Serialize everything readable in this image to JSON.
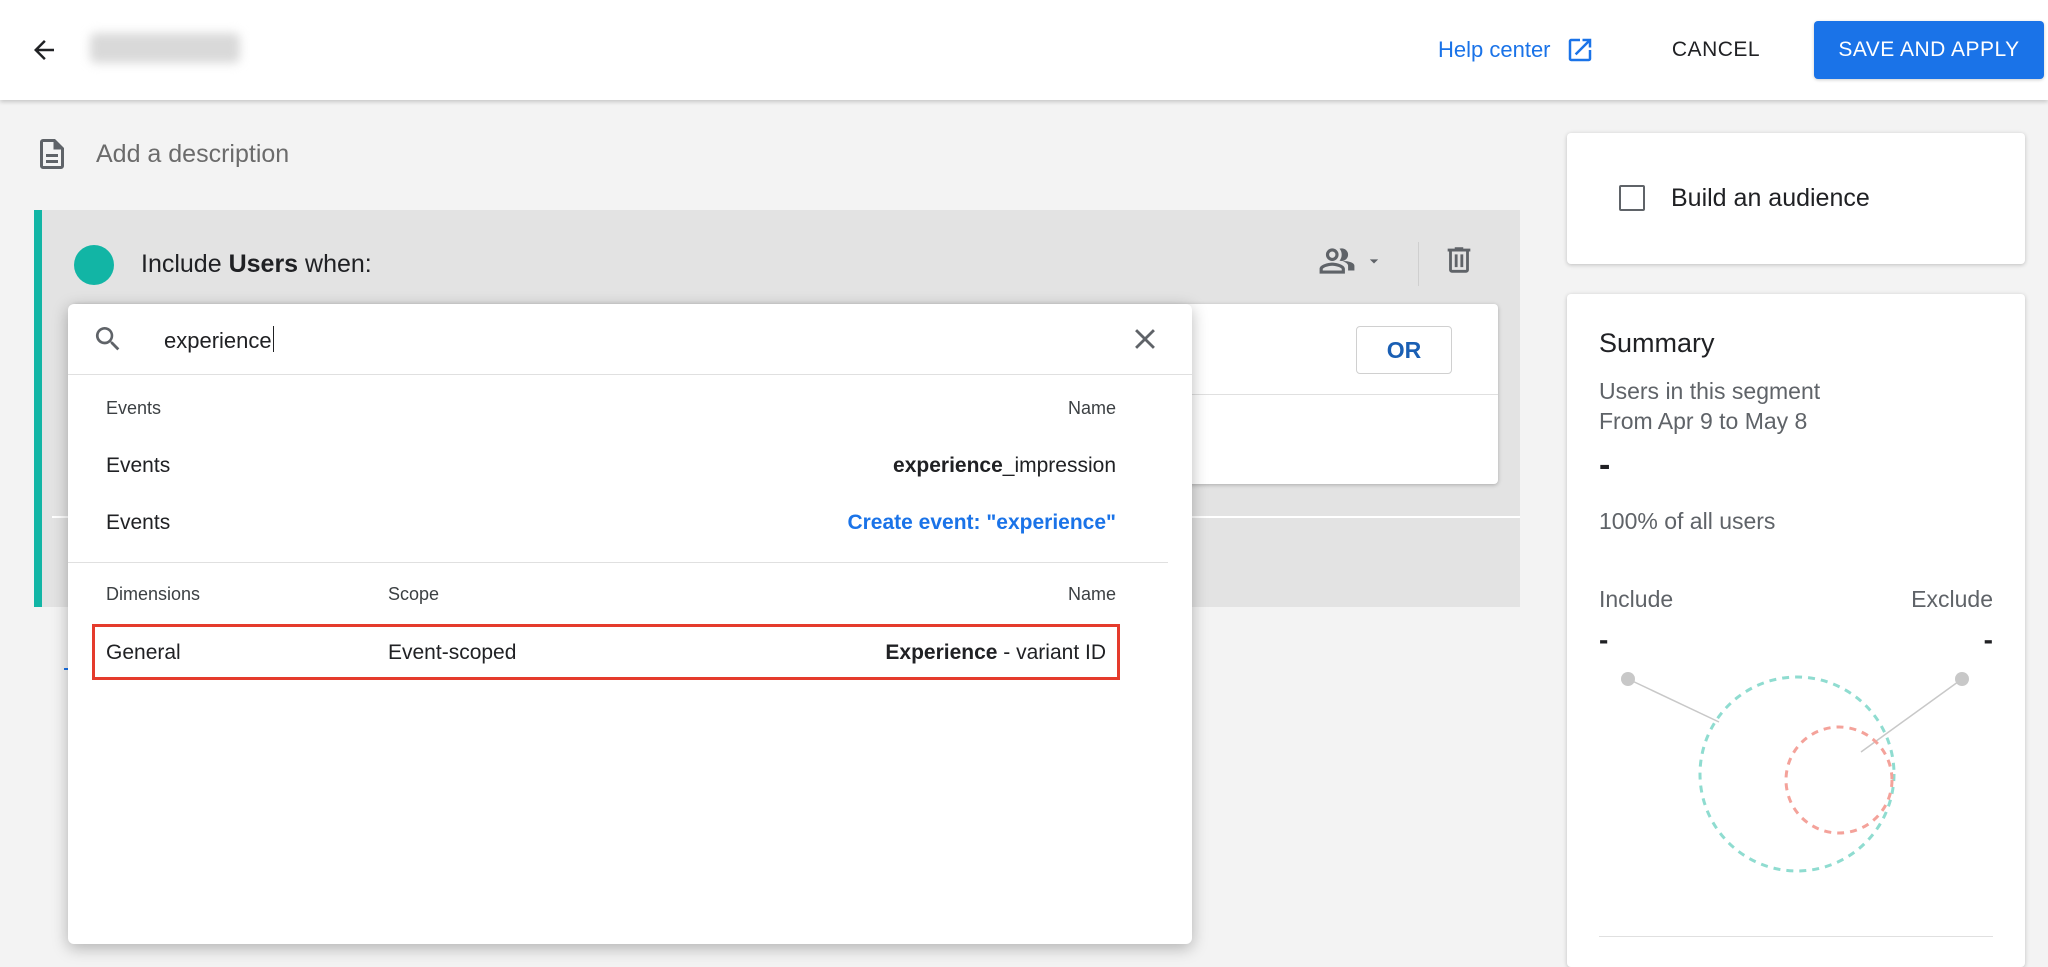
{
  "header": {
    "help_label": "Help center",
    "cancel_label": "CANCEL",
    "save_label": "SAVE AND APPLY"
  },
  "description": {
    "placeholder": "Add a description"
  },
  "condition": {
    "prefix": "Include",
    "entity": "Users",
    "suffix": "when:",
    "or_label": "OR"
  },
  "search": {
    "value": "experience"
  },
  "events_section": {
    "header_left": "Events",
    "header_right": "Name",
    "rows": [
      {
        "category": "Events",
        "name_bold": "experience",
        "name_rest": "_impression"
      },
      {
        "category": "Events",
        "create_label": "Create event: \"experience\""
      }
    ]
  },
  "dimensions_section": {
    "header_left": "Dimensions",
    "header_mid": "Scope",
    "header_right": "Name",
    "rows": [
      {
        "category": "General",
        "scope": "Event-scoped",
        "name_bold": "Experience",
        "name_rest": " - variant ID"
      }
    ]
  },
  "audience": {
    "label": "Build an audience",
    "checked": false
  },
  "summary": {
    "title": "Summary",
    "line1": "Users in this segment",
    "line2": "From Apr 9 to May 8",
    "count": "-",
    "percent": "100% of all users",
    "include_label": "Include",
    "exclude_label": "Exclude",
    "include_value": "-",
    "exclude_value": "-"
  },
  "colors": {
    "accent": "#1a73e8",
    "include": "#12b5a5",
    "exclude_circle": "#f28b82",
    "highlight": "#e53b2c"
  },
  "icons": [
    "arrow-back-icon",
    "open-in-new-icon",
    "description-icon",
    "people-icon",
    "dropdown-arrow-icon",
    "trash-icon",
    "search-icon",
    "close-icon"
  ]
}
